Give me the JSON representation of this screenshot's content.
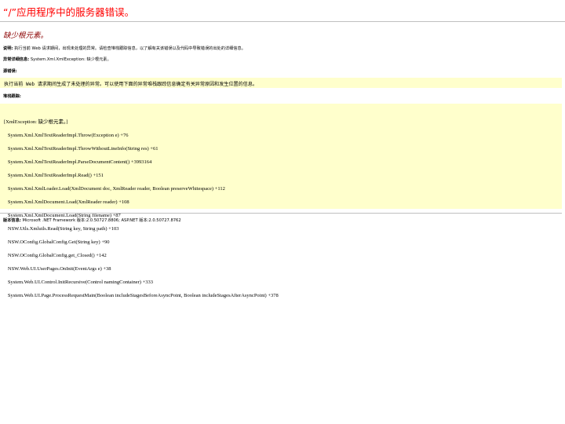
{
  "error_page": {
    "title": "“/”应用程序中的服务器错误。",
    "heading": "缺少根元素。",
    "description_label": "说明:",
    "description_text": " 执行当前 Web 请求期间，出现未处理的异常。请检查堆栈跟踪信息，以了解有关该错误以及代码中导致错误的出处的详细信息。",
    "exception_label": "异常详细信息:",
    "exception_text": " System.Xml.XmlException: 缺少根元素。",
    "source_label": "源错误:",
    "source_box_text": "执行当前 Web 请求期间生成了未处理的异常。可以使用下面的异常堆栈跟踪信息确定有关异常原因和发生位置的信息。",
    "stack_label": "堆栈跟踪:",
    "stack_lines": [
      "[XmlException: 缺少根元素。]",
      "   System.Xml.XmlTextReaderImpl.Throw(Exception e) +76",
      "   System.Xml.XmlTextReaderImpl.ThrowWithoutLineInfo(String res) +61",
      "   System.Xml.XmlTextReaderImpl.ParseDocumentContent() +3993164",
      "   System.Xml.XmlTextReaderImpl.Read() +151",
      "   System.Xml.XmlLoader.Load(XmlDocument doc, XmlReader reader, Boolean preserveWhitespace) +112",
      "   System.Xml.XmlDocument.Load(XmlReader reader) +108",
      "   System.Xml.XmlDocument.Load(String filename) +87",
      "   NSW.Utls.Xmlutls.Read(String key, String path) +103",
      "   NSW.OConfig.GlobalConfig.Get(String key) +90",
      "   NSW.OConfig.GlobalConfig.get_Closed() +142",
      "   NSW.Web.UI.UserPages.OnInit(EventArgs e) +38",
      "   System.Web.UI.Control.InitRecursive(Control namingContainer) +333",
      "   System.Web.UI.Page.ProcessRequestMain(Boolean includeStagesBeforeAsyncPoint, Boolean includeStagesAfterAsyncPoint) +378"
    ],
    "version_label": "版本信息:",
    "version_text": " Microsoft .NET Framework 版本:2.0.50727.8806; ASP.NET 版本:2.0.50727.8762"
  },
  "colors": {
    "title": "#ff0000",
    "heading": "#8b0000",
    "box_background": "#ffffcc"
  }
}
